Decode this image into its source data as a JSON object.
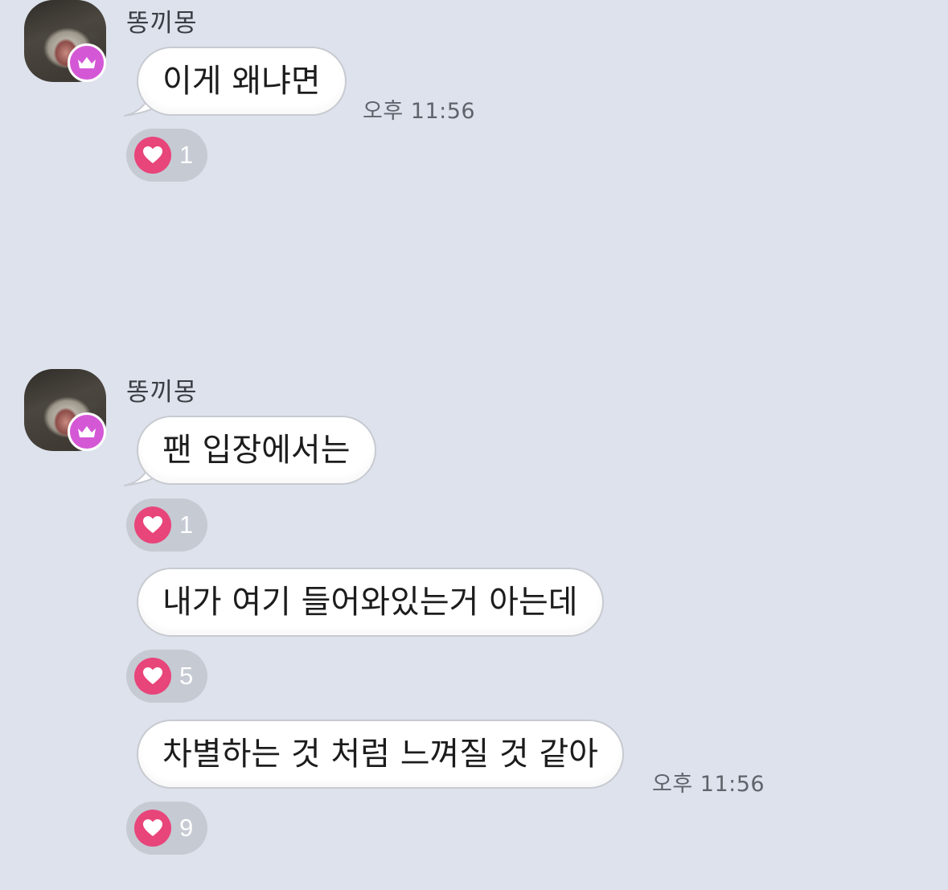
{
  "colors": {
    "background": "#dde2ec",
    "bubble": "#ffffff",
    "reaction_pill": "#c5cad3",
    "heart": "#e8457a",
    "crown_badge": "#d458d6"
  },
  "groups": [
    {
      "sender": "똥끼몽",
      "avatar_badge_icon": "crown-icon",
      "messages": [
        {
          "text": "이게 왜냐면",
          "time": "오후 11:56",
          "reactions": "1"
        }
      ]
    },
    {
      "sender": "똥끼몽",
      "avatar_badge_icon": "crown-icon",
      "messages": [
        {
          "text": "팬 입장에서는",
          "reactions": "1"
        },
        {
          "text": "내가 여기 들어와있는거 아는데",
          "reactions": "5"
        },
        {
          "text": "차별하는 것 처럼 느껴질 것 같아",
          "time": "오후 11:56",
          "reactions": "9"
        }
      ]
    }
  ]
}
